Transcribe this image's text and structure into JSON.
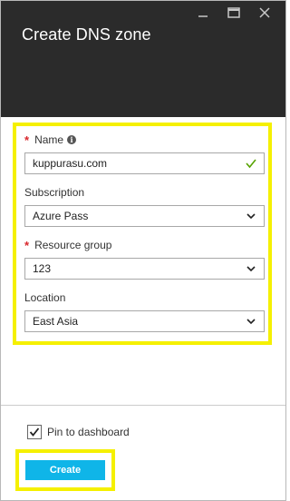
{
  "window": {
    "title": "Create DNS zone"
  },
  "form": {
    "name": {
      "required": "*",
      "label": "Name",
      "value": "kuppurasu.com",
      "valid": true
    },
    "subscription": {
      "label": "Subscription",
      "value": "Azure Pass"
    },
    "resource_group": {
      "required": "*",
      "label": "Resource group",
      "value": "123"
    },
    "location": {
      "label": "Location",
      "value": "East Asia"
    }
  },
  "footer": {
    "pin_label": "Pin to dashboard",
    "pin_checked": true,
    "create_label": "Create"
  },
  "colors": {
    "header_bg": "#2b2b2b",
    "highlight": "#f5f000",
    "accent": "#0fb5e8",
    "valid_check": "#57a300",
    "required": "#d9262c"
  }
}
